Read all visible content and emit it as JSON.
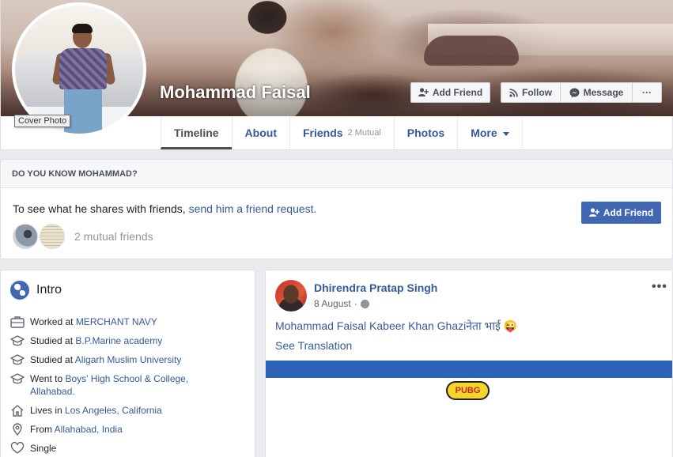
{
  "profile": {
    "name": "Mohammad Faisal",
    "cover_tooltip": "Cover Photo"
  },
  "cover_actions": {
    "add_friend": "Add Friend",
    "follow": "Follow",
    "message": "Message",
    "more": "···"
  },
  "tabs": [
    {
      "label": "Timeline",
      "active": true
    },
    {
      "label": "About"
    },
    {
      "label": "Friends",
      "sub": "2 Mutual"
    },
    {
      "label": "Photos"
    },
    {
      "label": "More"
    }
  ],
  "know": {
    "heading": "DO YOU KNOW MOHAMMAD?",
    "text_prefix": "To see what he shares with friends, ",
    "text_link": "send him a friend request.",
    "button": "Add Friend",
    "mutual": "2 mutual friends"
  },
  "intro": {
    "title": "Intro",
    "items": [
      {
        "icon": "briefcase-icon",
        "prefix": "Worked at ",
        "link": "MERCHANT NAVY"
      },
      {
        "icon": "graduation-cap-icon",
        "prefix": "Studied at ",
        "link": "B.P.Marine academy"
      },
      {
        "icon": "graduation-cap-icon",
        "prefix": "Studied at ",
        "link": "Aligarh Muslim University"
      },
      {
        "icon": "graduation-cap-icon",
        "prefix": "Went to ",
        "link": "Boys' High School & College, Allahabad."
      },
      {
        "icon": "home-icon",
        "prefix": "Lives in ",
        "link": "Los Angeles, California"
      },
      {
        "icon": "location-pin-icon",
        "prefix": "From ",
        "link": "Allahabad, India"
      },
      {
        "icon": "heart-icon",
        "prefix": "Single",
        "link": ""
      }
    ]
  },
  "post": {
    "author": "Dhirendra Pratap Singh",
    "date": "8 August",
    "separator": "·",
    "options": "•••",
    "text": "Mohammad Faisal Kabeer Khan Ghaziनेता भाई 😜",
    "translate": "See Translation",
    "media_logo": "PUBG"
  },
  "colors": {
    "brand_blue": "#4267b2",
    "link_blue": "#365899",
    "page_bg": "#e9ebee"
  }
}
